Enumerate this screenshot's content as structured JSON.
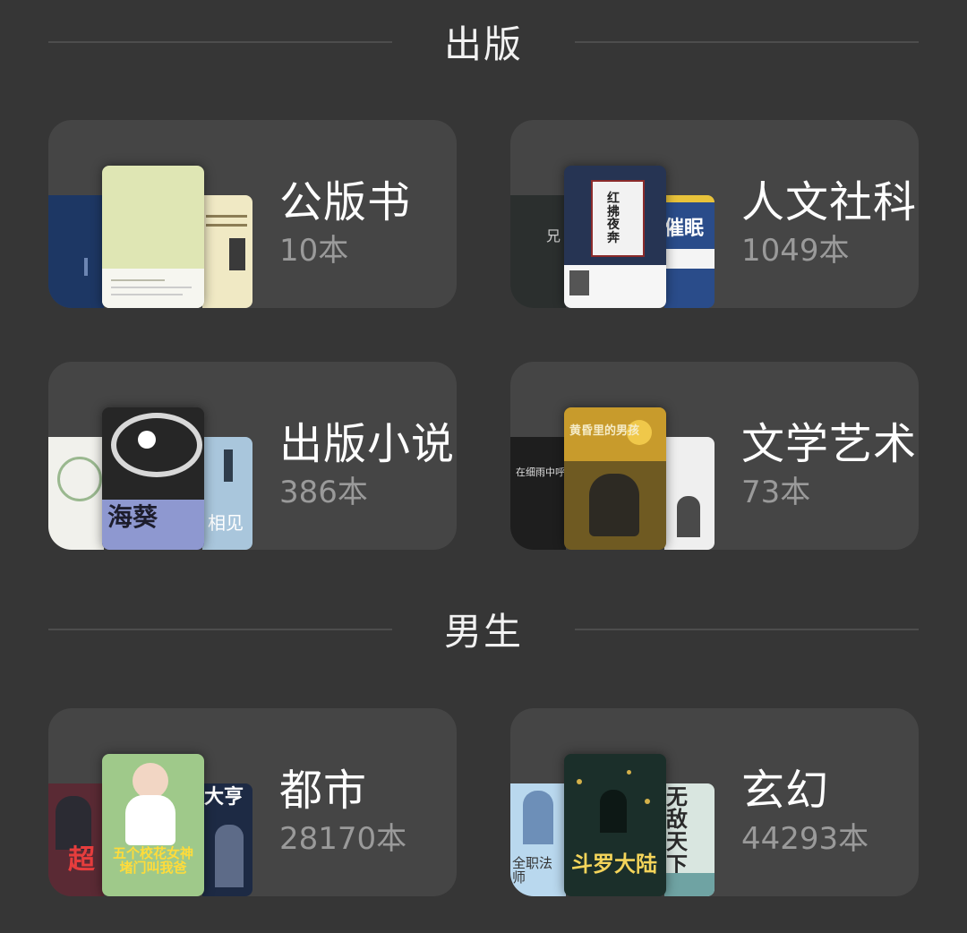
{
  "sections": [
    {
      "title": "出版",
      "cards": [
        {
          "title": "公版书",
          "count": "10本",
          "covers": {
            "back_left": {
              "color": "#1d3764",
              "text": ""
            },
            "front": {
              "color": "#dfe6b4",
              "text": ""
            },
            "back_right": {
              "color": "#f0e9c4",
              "text": ""
            }
          }
        },
        {
          "title": "人文社科",
          "count": "1049本",
          "covers": {
            "back_left": {
              "color": "#2b2f2e",
              "text": "兄"
            },
            "front": {
              "color": "#263453",
              "text": "红拂夜奔"
            },
            "back_right": {
              "color": "#2a4c8a",
              "text": "催眠"
            }
          }
        },
        {
          "title": "出版小说",
          "count": "386本",
          "covers": {
            "back_left": {
              "color": "#f1f1ec",
              "text": ""
            },
            "front": {
              "color": "#262626",
              "text": "海葵"
            },
            "back_right": {
              "color": "#a9c6dc",
              "text": "相见"
            }
          }
        },
        {
          "title": "文学艺术",
          "count": "73本",
          "covers": {
            "back_left": {
              "color": "#1e1e1e",
              "text": "在细雨中呼"
            },
            "front": {
              "color": "#6f5a22",
              "text": "黄昏里的男孩"
            },
            "back_right": {
              "color": "#efefef",
              "text": ""
            }
          }
        }
      ]
    },
    {
      "title": "男生",
      "cards": [
        {
          "title": "都市",
          "count": "28170本",
          "covers": {
            "back_left": {
              "color": "#5a2a34",
              "text": "超"
            },
            "front": {
              "color": "#9fc98a",
              "text": "五个校花女神 堵门叫我爸"
            },
            "back_right": {
              "color": "#1d2a44",
              "text": "大亨"
            }
          }
        },
        {
          "title": "玄幻",
          "count": "44293本",
          "covers": {
            "back_left": {
              "color": "#b9d8ee",
              "text": "全职法师"
            },
            "front": {
              "color": "#1b2f2a",
              "text": "斗罗大陆"
            },
            "back_right": {
              "color": "#d9e6e0",
              "text": "无敌天下"
            }
          }
        }
      ]
    }
  ]
}
